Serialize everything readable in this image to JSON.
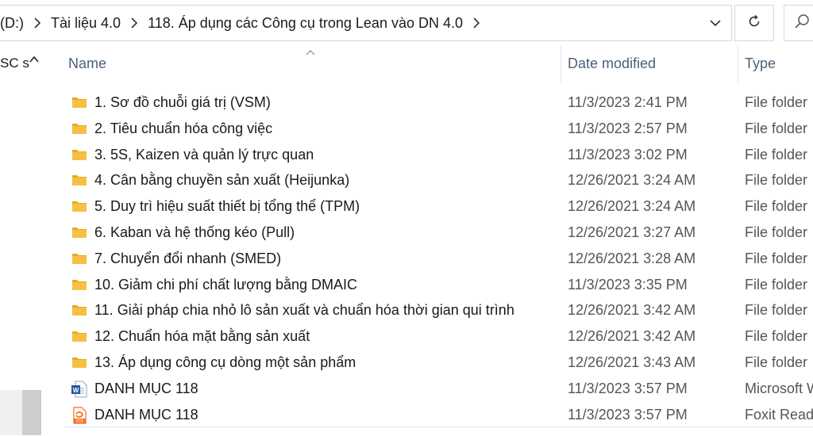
{
  "address": {
    "crumbs": [
      "(D:)",
      "Tài liệu 4.0",
      "118. Áp dụng các Công cụ trong Lean vào DN 4.0"
    ]
  },
  "nav": {
    "label": "SC s"
  },
  "columns": {
    "name": "Name",
    "date": "Date modified",
    "type": "Type"
  },
  "files": [
    {
      "name": "1. Sơ đồ chuỗi giá trị (VSM)",
      "date": "11/3/2023 2:41 PM",
      "type": "File folder",
      "icon": "folder-icon"
    },
    {
      "name": "2. Tiêu chuẩn hóa công việc",
      "date": "11/3/2023 2:57 PM",
      "type": "File folder",
      "icon": "folder-icon"
    },
    {
      "name": "3. 5S, Kaizen và quản lý trực quan",
      "date": "11/3/2023 3:02 PM",
      "type": "File folder",
      "icon": "folder-icon"
    },
    {
      "name": "4. Cân bằng chuyền sản xuất (Heijunka)",
      "date": "12/26/2021 3:24 AM",
      "type": "File folder",
      "icon": "folder-icon"
    },
    {
      "name": "5. Duy trì hiệu suất thiết bị tổng thể (TPM)",
      "date": "12/26/2021 3:24 AM",
      "type": "File folder",
      "icon": "folder-icon"
    },
    {
      "name": "6. Kaban và hệ thống kéo (Pull)",
      "date": "12/26/2021 3:27 AM",
      "type": "File folder",
      "icon": "folder-icon"
    },
    {
      "name": "7. Chuyển đổi nhanh (SMED)",
      "date": "12/26/2021 3:28 AM",
      "type": "File folder",
      "icon": "folder-icon"
    },
    {
      "name": "10. Giảm chi phí chất lượng bằng DMAIC",
      "date": "11/3/2023 3:35 PM",
      "type": "File folder",
      "icon": "folder-icon"
    },
    {
      "name": "11. Giải pháp chia nhỏ lô sản xuất và chuẩn hóa thời gian qui trình",
      "date": "12/26/2021 3:42 AM",
      "type": "File folder",
      "icon": "folder-icon"
    },
    {
      "name": "12. Chuẩn hóa mặt bằng sản xuất",
      "date": "12/26/2021 3:42 AM",
      "type": "File folder",
      "icon": "folder-icon"
    },
    {
      "name": "13. Áp dụng công cụ dòng một sản phẩm",
      "date": "12/26/2021 3:43 AM",
      "type": "File folder",
      "icon": "folder-icon"
    },
    {
      "name": "DANH MỤC 118",
      "date": "11/3/2023 3:57 PM",
      "type": "Microsoft W",
      "icon": "word-doc-icon"
    },
    {
      "name": "DANH MỤC 118",
      "date": "11/3/2023 3:57 PM",
      "type": "Foxit Read",
      "icon": "pdf-doc-icon"
    }
  ],
  "colors": {
    "folder": "#f5c044",
    "word": "#2b579a",
    "pdf": "#f36f21",
    "header": "#4c607a"
  }
}
